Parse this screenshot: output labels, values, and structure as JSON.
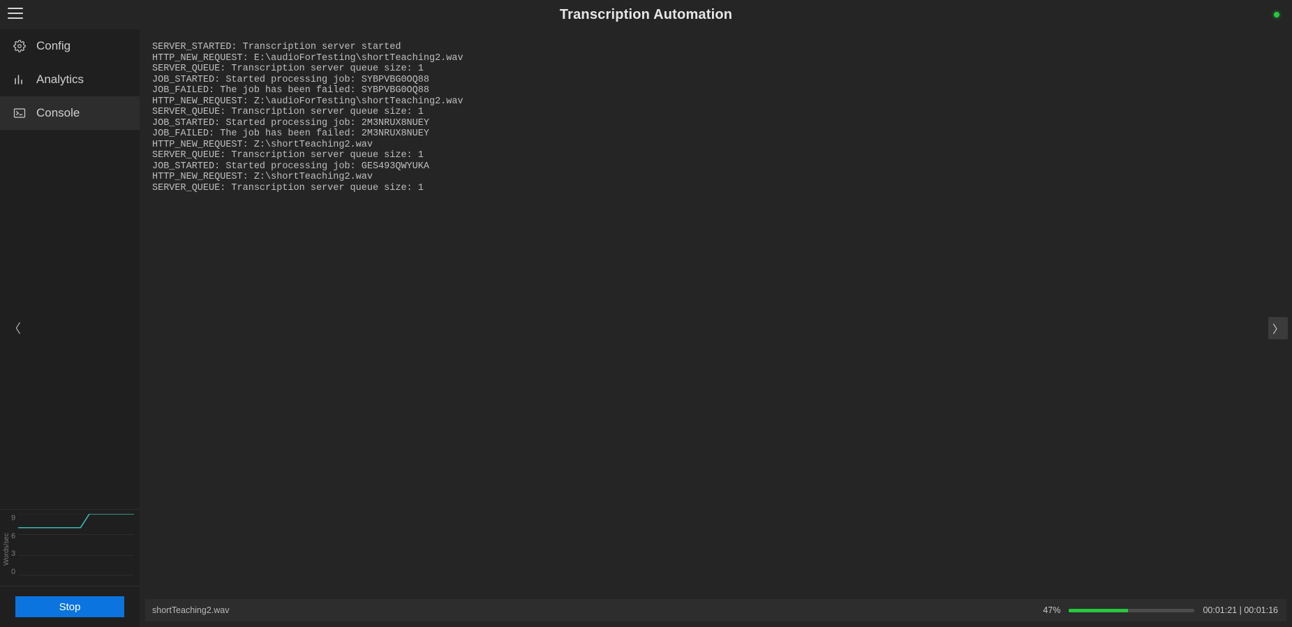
{
  "header": {
    "title": "Transcription Automation",
    "status_color": "#28c93e"
  },
  "sidebar": {
    "items": [
      {
        "label": "Config"
      },
      {
        "label": "Analytics"
      },
      {
        "label": "Console"
      }
    ],
    "collapse_left_glyph": "〈",
    "stop_label": "Stop"
  },
  "main": {
    "expand_right_glyph": "〉"
  },
  "console": {
    "lines": [
      "SERVER_STARTED: Transcription server started",
      "HTTP_NEW_REQUEST: E:\\audioForTesting\\shortTeaching2.wav",
      "SERVER_QUEUE: Transcription server queue size: 1",
      "JOB_STARTED: Started processing job: SYBPVBG0OQ88",
      "JOB_FAILED: The job has been failed: SYBPVBG0OQ88",
      "HTTP_NEW_REQUEST: Z:\\audioForTesting\\shortTeaching2.wav",
      "SERVER_QUEUE: Transcription server queue size: 1",
      "JOB_STARTED: Started processing job: 2M3NRUX8NUEY",
      "JOB_FAILED: The job has been failed: 2M3NRUX8NUEY",
      "HTTP_NEW_REQUEST: Z:\\shortTeaching2.wav",
      "SERVER_QUEUE: Transcription server queue size: 1",
      "JOB_STARTED: Started processing job: GES493QWYUKA",
      "HTTP_NEW_REQUEST: Z:\\shortTeaching2.wav",
      "SERVER_QUEUE: Transcription server queue size: 1"
    ]
  },
  "chart_data": {
    "type": "line",
    "ylabel": "Words/sec",
    "ylim": [
      0,
      9
    ],
    "ticks": [
      "9",
      "6",
      "3",
      "0"
    ],
    "x": [
      0,
      1,
      2,
      3,
      4,
      5,
      6,
      7,
      8,
      9,
      10,
      11,
      12,
      13
    ],
    "values": [
      7,
      7,
      7,
      7,
      7,
      7,
      7,
      7,
      9,
      9,
      9,
      9,
      9,
      9
    ]
  },
  "progress": {
    "file": "shortTeaching2.wav",
    "percent": 47,
    "percent_label": "47%",
    "elapsed": "00:01:21",
    "remaining": "00:01:16",
    "separator": " | "
  }
}
